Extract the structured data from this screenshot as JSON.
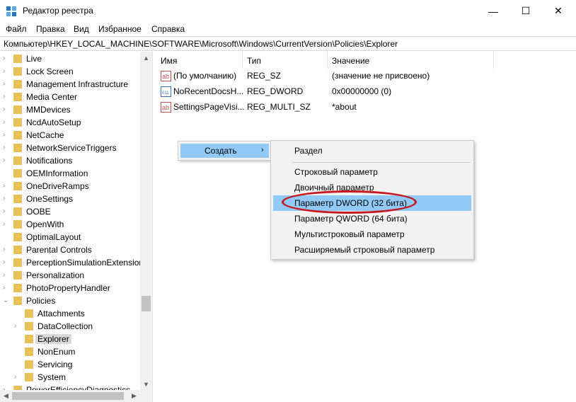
{
  "window": {
    "title": "Редактор реестра",
    "minimize_glyph": "—",
    "maximize_glyph": "☐",
    "close_glyph": "✕"
  },
  "menu": [
    "Файл",
    "Правка",
    "Вид",
    "Избранное",
    "Справка"
  ],
  "address": "Компьютер\\HKEY_LOCAL_MACHINE\\SOFTWARE\\Microsoft\\Windows\\CurrentVersion\\Policies\\Explorer",
  "tree": [
    {
      "label": "Live",
      "indent": 0,
      "expander": "›"
    },
    {
      "label": "Lock Screen",
      "indent": 0,
      "expander": "›"
    },
    {
      "label": "Management Infrastructure",
      "indent": 0,
      "expander": "›"
    },
    {
      "label": "Media Center",
      "indent": 0,
      "expander": "›"
    },
    {
      "label": "MMDevices",
      "indent": 0,
      "expander": "›"
    },
    {
      "label": "NcdAutoSetup",
      "indent": 0,
      "expander": "›"
    },
    {
      "label": "NetCache",
      "indent": 0,
      "expander": "›"
    },
    {
      "label": "NetworkServiceTriggers",
      "indent": 0,
      "expander": "›"
    },
    {
      "label": "Notifications",
      "indent": 0,
      "expander": "›"
    },
    {
      "label": "OEMInformation",
      "indent": 0,
      "expander": ""
    },
    {
      "label": "OneDriveRamps",
      "indent": 0,
      "expander": "›"
    },
    {
      "label": "OneSettings",
      "indent": 0,
      "expander": "›"
    },
    {
      "label": "OOBE",
      "indent": 0,
      "expander": "›"
    },
    {
      "label": "OpenWith",
      "indent": 0,
      "expander": "›"
    },
    {
      "label": "OptimalLayout",
      "indent": 0,
      "expander": ""
    },
    {
      "label": "Parental Controls",
      "indent": 0,
      "expander": "›"
    },
    {
      "label": "PerceptionSimulationExtension",
      "indent": 0,
      "expander": "›"
    },
    {
      "label": "Personalization",
      "indent": 0,
      "expander": "›"
    },
    {
      "label": "PhotoPropertyHandler",
      "indent": 0,
      "expander": "›"
    },
    {
      "label": "Policies",
      "indent": 0,
      "expander": "⌄"
    },
    {
      "label": "Attachments",
      "indent": 1,
      "expander": ""
    },
    {
      "label": "DataCollection",
      "indent": 1,
      "expander": "›"
    },
    {
      "label": "Explorer",
      "indent": 1,
      "expander": "",
      "selected": true
    },
    {
      "label": "NonEnum",
      "indent": 1,
      "expander": ""
    },
    {
      "label": "Servicing",
      "indent": 1,
      "expander": ""
    },
    {
      "label": "System",
      "indent": 1,
      "expander": "›"
    },
    {
      "label": "PowerEfficiencyDiagnostics",
      "indent": 0,
      "expander": "›"
    }
  ],
  "columns": {
    "name": "Имя",
    "type": "Тип",
    "value": "Значение"
  },
  "values": [
    {
      "icon": "ab",
      "name": "(По умолчанию)",
      "type": "REG_SZ",
      "data": "(значение не присвоено)"
    },
    {
      "icon": "bin",
      "name": "NoRecentDocsH...",
      "type": "REG_DWORD",
      "data": "0x00000000 (0)"
    },
    {
      "icon": "ab",
      "name": "SettingsPageVisi...",
      "type": "REG_MULTI_SZ",
      "data": "*about"
    }
  ],
  "context_menu": {
    "label": "Создать",
    "arrow": "›"
  },
  "submenu": {
    "key": "Раздел",
    "items": [
      "Строковый параметр",
      "Двоичный параметр",
      "Параметр DWORD (32 бита)",
      "Параметр QWORD (64 бита)",
      "Мультистроковый параметр",
      "Расширяемый строковый параметр"
    ],
    "highlighted_index": 2
  },
  "colors": {
    "folder": "#e8c15a",
    "selection": "#91c9f7",
    "annotation": "#c8161d"
  }
}
